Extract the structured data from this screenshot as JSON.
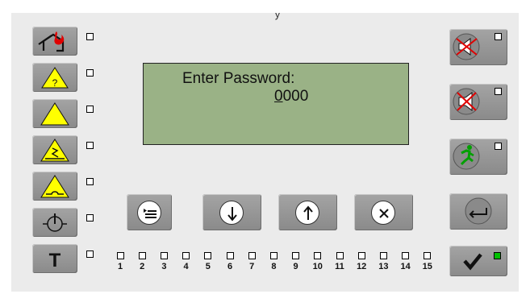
{
  "lcd": {
    "line1": "Enter Password:",
    "cursor_digit": "0",
    "rest_digits": "000"
  },
  "left_keys": [
    {
      "name": "fire-alarm-key",
      "icon": "house-fire-icon"
    },
    {
      "name": "fault-key",
      "icon": "warning-question-icon"
    },
    {
      "name": "warning-key",
      "icon": "warning-triangle-icon"
    },
    {
      "name": "power-fault-key",
      "icon": "warning-lightning-icon"
    },
    {
      "name": "disable-key",
      "icon": "warning-disabled-icon"
    },
    {
      "name": "test-key",
      "icon": "power-test-icon"
    },
    {
      "name": "t-key",
      "icon": "letter-t-icon",
      "label": "T"
    }
  ],
  "right_keys": [
    {
      "name": "buzzer-silence-key",
      "icon": "muted-speaker-icon"
    },
    {
      "name": "siren-silence-key",
      "icon": "muted-siren-icon"
    },
    {
      "name": "evacuate-key",
      "icon": "exit-running-man-icon"
    },
    {
      "name": "back-key",
      "icon": "back-arrow-icon"
    },
    {
      "name": "confirm-key",
      "icon": "checkmark-icon",
      "led": "green"
    }
  ],
  "nav_buttons": [
    {
      "name": "menu-button",
      "icon": "menu-icon"
    },
    {
      "name": "down-button",
      "icon": "down-arrow-icon"
    },
    {
      "name": "up-button",
      "icon": "up-arrow-icon"
    },
    {
      "name": "cancel-button",
      "icon": "close-icon"
    }
  ],
  "zones": [
    "1",
    "2",
    "3",
    "4",
    "5",
    "6",
    "7",
    "8",
    "9",
    "10",
    "11",
    "12",
    "13",
    "14",
    "15"
  ],
  "header_fragment": "y",
  "colors": {
    "panel": "#ebebeb",
    "key": "#9a9a9a",
    "lcd": "#9ab286",
    "warning_yellow": "#ffff00",
    "fire_red": "#e00000",
    "exit_green": "#00a000",
    "led_on": "#00c000"
  }
}
